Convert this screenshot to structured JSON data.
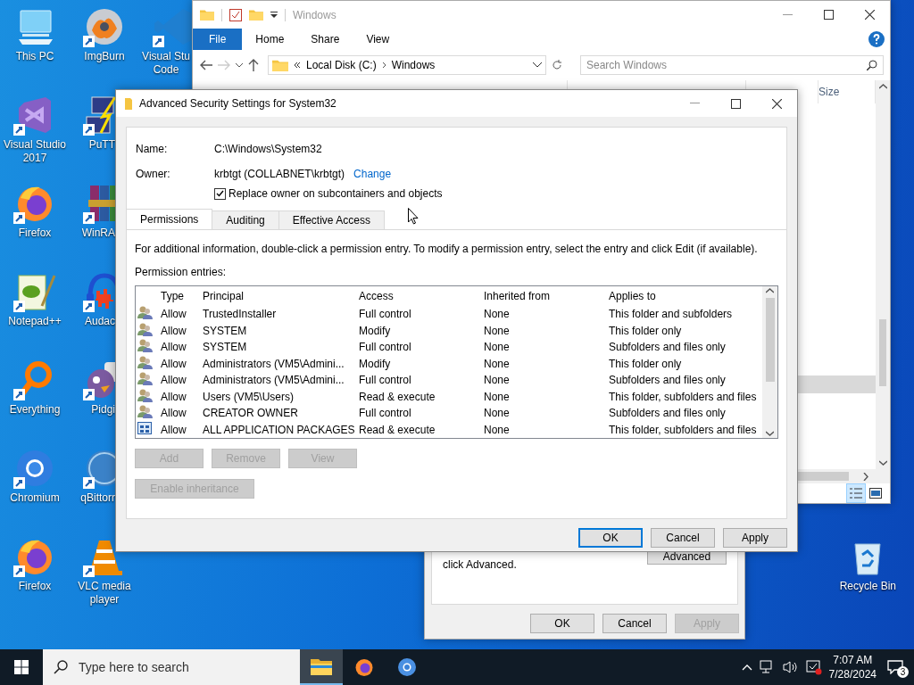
{
  "desktop": {
    "icons": [
      {
        "label": "This PC",
        "kind": "pc",
        "shortcut": false
      },
      {
        "label": "Visual Studio\n2017",
        "kind": "vs",
        "shortcut": true
      },
      {
        "label": "Firefox",
        "kind": "firefox",
        "shortcut": true
      },
      {
        "label": "Notepad++",
        "kind": "notepad",
        "shortcut": true
      },
      {
        "label": "Everything",
        "kind": "everything",
        "shortcut": true
      },
      {
        "label": "Chromium",
        "kind": "chromium",
        "shortcut": true
      },
      {
        "label": "Firefox",
        "kind": "firefox",
        "shortcut": true
      },
      {
        "label": "ImgBurn",
        "kind": "disc",
        "shortcut": true
      },
      {
        "label": "PuTT",
        "kind": "putty",
        "shortcut": true
      },
      {
        "label": "WinRA",
        "kind": "winrar",
        "shortcut": true
      },
      {
        "label": "Audac",
        "kind": "audacity",
        "shortcut": true
      },
      {
        "label": "Pidgi",
        "kind": "pidgin",
        "shortcut": true
      },
      {
        "label": "qBittorr",
        "kind": "qbittorrent",
        "shortcut": true
      },
      {
        "label": "VLC media\nplayer",
        "kind": "vlc",
        "shortcut": true
      },
      {
        "label": "Visual Stu\nCode",
        "kind": "vscode",
        "shortcut": true
      }
    ],
    "recycle_bin": {
      "label": "Recycle Bin"
    }
  },
  "explorer": {
    "title": "Windows",
    "ribbon_tabs": [
      {
        "label": "File",
        "selected": true
      },
      {
        "label": "Home",
        "selected": false
      },
      {
        "label": "Share",
        "selected": false
      },
      {
        "label": "View",
        "selected": false
      }
    ],
    "address": {
      "path": [
        "Local Disk (C:)",
        "Windows"
      ]
    },
    "search": {
      "placeholder": "Search Windows"
    },
    "columns": [
      "Size"
    ]
  },
  "properties_dialog": {
    "note": "click Advanced.",
    "advanced_button": "Advanced",
    "buttons": [
      {
        "label": "OK",
        "disabled": false
      },
      {
        "label": "Cancel",
        "disabled": false
      },
      {
        "label": "Apply",
        "disabled": true
      }
    ]
  },
  "security_dialog": {
    "title": "Advanced Security Settings for System32",
    "name_label": "Name:",
    "name_value": "C:\\Windows\\System32",
    "owner_label": "Owner:",
    "owner_value": "krbtgt (COLLABNET\\krbtgt)",
    "change_link": "Change",
    "replace_owner": {
      "label": "Replace owner on subcontainers and objects",
      "checked": true
    },
    "tabs": [
      {
        "label": "Permissions",
        "selected": true
      },
      {
        "label": "Auditing",
        "selected": false
      },
      {
        "label": "Effective Access",
        "selected": false
      }
    ],
    "info": "For additional information, double-click a permission entry. To modify a permission entry, select the entry and click Edit (if available).",
    "entries_label": "Permission entries:",
    "table": {
      "columns": [
        "Type",
        "Principal",
        "Access",
        "Inherited from",
        "Applies to"
      ],
      "rows": [
        {
          "kind": "group",
          "cells": [
            "Allow",
            "TrustedInstaller",
            "Full control",
            "None",
            "This folder and subfolders"
          ]
        },
        {
          "kind": "group",
          "cells": [
            "Allow",
            "SYSTEM",
            "Modify",
            "None",
            "This folder only"
          ]
        },
        {
          "kind": "group",
          "cells": [
            "Allow",
            "SYSTEM",
            "Full control",
            "None",
            "Subfolders and files only"
          ]
        },
        {
          "kind": "group",
          "cells": [
            "Allow",
            "Administrators (VM5\\Admini...",
            "Modify",
            "None",
            "This folder only"
          ]
        },
        {
          "kind": "group",
          "cells": [
            "Allow",
            "Administrators (VM5\\Admini...",
            "Full control",
            "None",
            "Subfolders and files only"
          ]
        },
        {
          "kind": "group",
          "cells": [
            "Allow",
            "Users (VM5\\Users)",
            "Read & execute",
            "None",
            "This folder, subfolders and files"
          ]
        },
        {
          "kind": "group",
          "cells": [
            "Allow",
            "CREATOR OWNER",
            "Full control",
            "None",
            "Subfolders and files only"
          ]
        },
        {
          "kind": "package",
          "cells": [
            "Allow",
            "ALL APPLICATION PACKAGES",
            "Read & execute",
            "None",
            "This folder, subfolders and files"
          ]
        }
      ]
    },
    "entry_buttons": [
      {
        "label": "Add",
        "disabled": true
      },
      {
        "label": "Remove",
        "disabled": true
      },
      {
        "label": "View",
        "disabled": true
      }
    ],
    "inheritance_button": {
      "label": "Enable inheritance",
      "disabled": true
    },
    "buttons": [
      {
        "label": "OK",
        "disabled": false,
        "default": true
      },
      {
        "label": "Cancel",
        "disabled": false,
        "default": false
      },
      {
        "label": "Apply",
        "disabled": false,
        "default": false
      }
    ]
  },
  "taskbar": {
    "search": {
      "placeholder": "Type here to search"
    },
    "apps": [
      {
        "kind": "explorer",
        "selected": true
      },
      {
        "kind": "firefox",
        "selected": false
      },
      {
        "kind": "chromium",
        "selected": false
      }
    ],
    "time": "7:07 AM",
    "date": "7/28/2024",
    "notifications": "3"
  }
}
